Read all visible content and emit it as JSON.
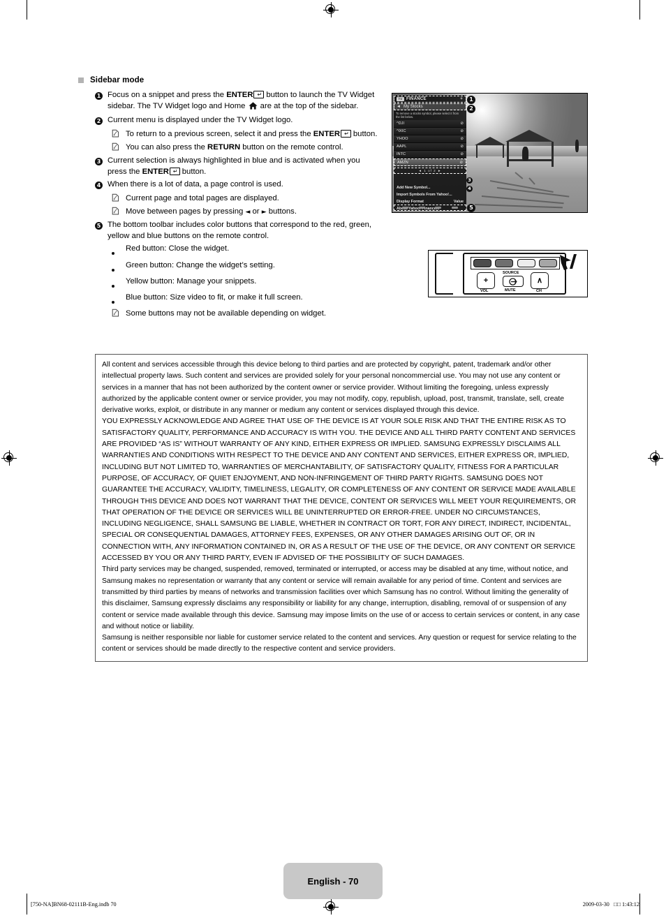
{
  "section": {
    "heading": "Sidebar mode"
  },
  "steps": [
    {
      "num": "❶",
      "parts": [
        {
          "t": "Focus on a snippet and press the ",
          "style": "normal"
        },
        {
          "t": "ENTER",
          "style": "bold"
        },
        {
          "t": "enter-key-icon",
          "style": "icon"
        },
        {
          "t": " button to launch the TV Widget sidebar. The TV Widget logo and Home ",
          "style": "normal"
        },
        {
          "t": "home-icon",
          "style": "icon"
        },
        {
          "t": " are at the top of the sidebar.",
          "style": "normal"
        }
      ],
      "plain": "Focus on a snippet and press the ENTER button to launch the TV Widget sidebar. The TV Widget logo and Home are at the top of the sidebar."
    },
    {
      "num": "❷",
      "plain": "Current menu is displayed under the TV Widget logo.",
      "notes": [
        "To return to a previous screen, select it and press the ENTER button.",
        "You can also press the RETURN button on the remote control."
      ]
    },
    {
      "num": "❸",
      "plain": "Current selection is always highlighted in blue and is activated when you press the ENTER button."
    },
    {
      "num": "❹",
      "plain": "When there is a lot of data, a page control is used.",
      "notes": [
        "Current page and total pages are displayed.",
        "Move between pages by pressing ◄ or ► buttons."
      ]
    },
    {
      "num": "❺",
      "plain": "The bottom toolbar includes color buttons that correspond to the red, green, yellow and blue buttons on the remote control.",
      "bullets": [
        "Red button: Close the widget.",
        "Green button: Change the widget’s setting.",
        "Yellow button: Manage your snippets.",
        "Blue button: Size video to fit, or make it full screen."
      ],
      "notes": [
        "Some buttons may not be available depending on widget."
      ]
    }
  ],
  "step_text": {
    "s1_a": "Focus on a snippet and press the ",
    "s1_enter": "ENTER",
    "s1_b": " button to launch the TV Widget sidebar. The TV Widget logo and Home ",
    "s1_c": " are at the top of the sidebar.",
    "s2": "Current menu is displayed under the TV Widget logo.",
    "s2_n1_a": "To return to a previous screen, select it and press the ",
    "s2_n1_enter": "ENTER",
    "s2_n1_b": " button.",
    "s2_n2_a": "You can also press the ",
    "s2_n2_b": "RETURN",
    "s2_n2_c": " button on the remote control.",
    "s3_a": "Current selection is always highlighted in blue and is activated when you press the ",
    "s3_enter": "ENTER",
    "s3_b": " button.",
    "s4": "When there is a lot of data, a page control is used.",
    "s4_n1": "Current page and total pages are displayed.",
    "s4_n2_a": "Move between pages by pressing ",
    "s4_n2_left": "◄",
    "s4_n2_mid": " or ",
    "s4_n2_right": "►",
    "s4_n2_b": " buttons.",
    "s5": "The bottom toolbar includes color buttons that correspond to the red, green, yellow and blue buttons on the remote control.",
    "s5_b1": "Red button: Close the widget.",
    "s5_b2": "Green button: Change the widget’s setting.",
    "s5_b3": "Yellow button: Manage your snippets.",
    "s5_b4": "Blue button: Size video to fit, or make it full screen.",
    "s5_n1": "Some buttons may not be available depending on widget."
  },
  "tv_figure": {
    "sidebar": {
      "logo_text": "TV",
      "title": "FINANCE",
      "title_plus": "+",
      "back_arrow": "◄",
      "menu": "My Stocks",
      "description": "To remove a stocks symbol, please select it from the list below.",
      "items": [
        {
          "symbol": "^DJI",
          "action": "⊘"
        },
        {
          "symbol": "^IXIC",
          "action": "⊘"
        },
        {
          "symbol": "YHOO",
          "action": "⊘"
        },
        {
          "symbol": "AAPL",
          "action": "⊘"
        },
        {
          "symbol": "INTC",
          "action": "⊘"
        },
        {
          "symbol": "AMZN",
          "action": "⊘",
          "selected": true
        }
      ],
      "page_control": "◄  1 of 2  ►",
      "options": [
        {
          "label": "Add New Symbol...",
          "value": ""
        },
        {
          "label": "Import Symbols From Yahoo!...",
          "value": ""
        },
        {
          "label": "Display Format",
          "value": "Value"
        },
        {
          "label": "About Yahoo! Finance...",
          "value": ""
        }
      ]
    },
    "callouts": [
      "1",
      "2",
      "3",
      "4",
      "5"
    ]
  },
  "remote_figure": {
    "vol_plus": "+",
    "vol_label": "VOL",
    "source_label": "SOURCE",
    "mute_label": "MUTE",
    "ch_up": "∧",
    "ch_label": "CH",
    "color_buttons": [
      "red-button",
      "green-button",
      "yellow-button",
      "blue-button"
    ]
  },
  "legal": {
    "p1": "All content and services accessible through this device belong to third parties and are protected by copyright, patent, trademark and/or other intellectual property laws. Such content and services are provided solely for your personal noncommercial use. You may not use any content or services in a manner that has not been authorized by the content owner or service provider. Without limiting the foregoing, unless expressly authorized by the applicable content owner or service provider, you may not modify, copy, republish, upload, post, transmit, translate, sell, create derivative works, exploit, or distribute in any manner or medium any content or services displayed through this device.",
    "p2": "YOU EXPRESSLY ACKNOWLEDGE AND AGREE THAT USE OF THE DEVICE IS AT YOUR SOLE RISK AND THAT THE ENTIRE RISK AS TO SATISFACTORY QUALITY, PERFORMANCE AND ACCURACY IS WITH YOU. THE DEVICE AND ALL THIRD PARTY CONTENT AND SERVICES ARE PROVIDED “AS IS” WITHOUT WARRANTY OF ANY KIND, EITHER EXPRESS OR IMPLIED. SAMSUNG EXPRESSLY DISCLAIMS ALL WARRANTIES AND CONDITIONS WITH RESPECT TO THE DEVICE AND ANY CONTENT AND SERVICES, EITHER EXPRESS OR, IMPLIED, INCLUDING BUT NOT LIMITED TO, WARRANTIES OF MERCHANTABILITY, OF SATISFACTORY QUALITY, FITNESS FOR A PARTICULAR PURPOSE, OF ACCURACY, OF QUIET ENJOYMENT, AND NON-INFRINGEMENT OF THIRD PARTY RIGHTS. SAMSUNG DOES NOT GUARANTEE THE ACCURACY, VALIDITY, TIMELINESS, LEGALITY, OR COMPLETENESS OF ANY CONTENT OR SERVICE MADE AVAILABLE THROUGH THIS DEVICE AND DOES NOT WARRANT THAT THE DEVICE, CONTENT OR SERVICES WILL MEET YOUR REQUIREMENTS, OR THAT OPERATION OF THE DEVICE OR SERVICES WILL BE UNINTERRUPTED OR ERROR-FREE. UNDER NO CIRCUMSTANCES, INCLUDING NEGLIGENCE, SHALL SAMSUNG BE LIABLE, WHETHER IN CONTRACT OR TORT, FOR ANY DIRECT, INDIRECT, INCIDENTAL, SPECIAL OR CONSEQUENTIAL DAMAGES, ATTORNEY FEES, EXPENSES, OR ANY OTHER DAMAGES ARISING OUT OF, OR IN CONNECTION WITH, ANY INFORMATION CONTAINED IN, OR AS A RESULT OF THE USE OF THE DEVICE, OR ANY CONTENT OR SERVICE ACCESSED BY YOU OR ANY THIRD PARTY, EVEN IF ADVISED OF THE POSSIBILITY OF SUCH DAMAGES.",
    "p3": "Third party services may be changed, suspended, removed, terminated or interrupted, or access may be disabled at any time, without notice, and Samsung makes no representation or warranty that any content or service will remain available for any period of time. Content and services are transmitted by third parties by means of networks and transmission facilities over which Samsung has no control. Without limiting the generality of this disclaimer, Samsung expressly disclaims any responsibility or liability for any change, interruption, disabling, removal of or suspension of any content or service made available through this device. Samsung may impose limits on the use of or access to certain services or content, in any case and without notice or liability.",
    "p4": "Samsung is neither responsible nor liable for customer service related to the content and services. Any question or request for service relating to the content or services should be made directly to the respective content and service providers."
  },
  "footer": {
    "page_label": "English - 70",
    "file_ref": "[750-NA]BN68-02111B-Eng.indb   70",
    "timestamp": "2009-03-30   □□ 1:43:12"
  }
}
